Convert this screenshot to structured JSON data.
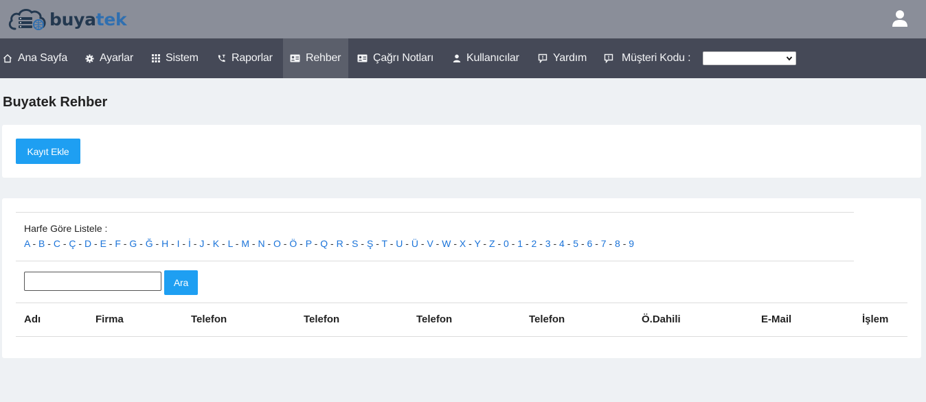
{
  "brand": {
    "name_part1": "buya",
    "name_part2": "tek"
  },
  "nav": {
    "items": [
      {
        "label": "Ana Sayfa",
        "icon": "home-icon"
      },
      {
        "label": "Ayarlar",
        "icon": "gear-icon"
      },
      {
        "label": "Sistem",
        "icon": "grid-icon"
      },
      {
        "label": "Raporlar",
        "icon": "phone-icon"
      },
      {
        "label": "Rehber",
        "icon": "contact-card-icon",
        "active": true
      },
      {
        "label": "Çağrı Notları",
        "icon": "contact-card-icon"
      },
      {
        "label": "Kullanıcılar",
        "icon": "user-icon"
      },
      {
        "label": "Yardım",
        "icon": "chat-icon"
      },
      {
        "label": "Müşteri Kodu :",
        "icon": "chat-icon"
      }
    ],
    "customer_code_selected": ""
  },
  "page": {
    "title": "Buyatek Rehber"
  },
  "actions": {
    "add_label": "Kayıt Ekle"
  },
  "filter": {
    "label": "Harfe Göre Listele :",
    "letters": [
      "A",
      "B",
      "C",
      "Ç",
      "D",
      "E",
      "F",
      "G",
      "Ğ",
      "H",
      "I",
      "İ",
      "J",
      "K",
      "L",
      "M",
      "N",
      "O",
      "Ö",
      "P",
      "Q",
      "R",
      "S",
      "Ş",
      "T",
      "U",
      "Ü",
      "V",
      "W",
      "X",
      "Y",
      "Z",
      "0",
      "1",
      "2",
      "3",
      "4",
      "5",
      "6",
      "7",
      "8",
      "9"
    ],
    "separator": " - "
  },
  "search": {
    "value": "",
    "button_label": "Ara"
  },
  "table": {
    "columns": [
      "Adı",
      "Firma",
      "Telefon",
      "Telefon",
      "Telefon",
      "Telefon",
      "Ö.Dahili",
      "E-Mail",
      "İşlem"
    ],
    "rows": []
  },
  "colors": {
    "accent": "#1e9ff2",
    "topbar": "#8a8e99",
    "navbar": "#454957",
    "link": "#1a73d9"
  }
}
